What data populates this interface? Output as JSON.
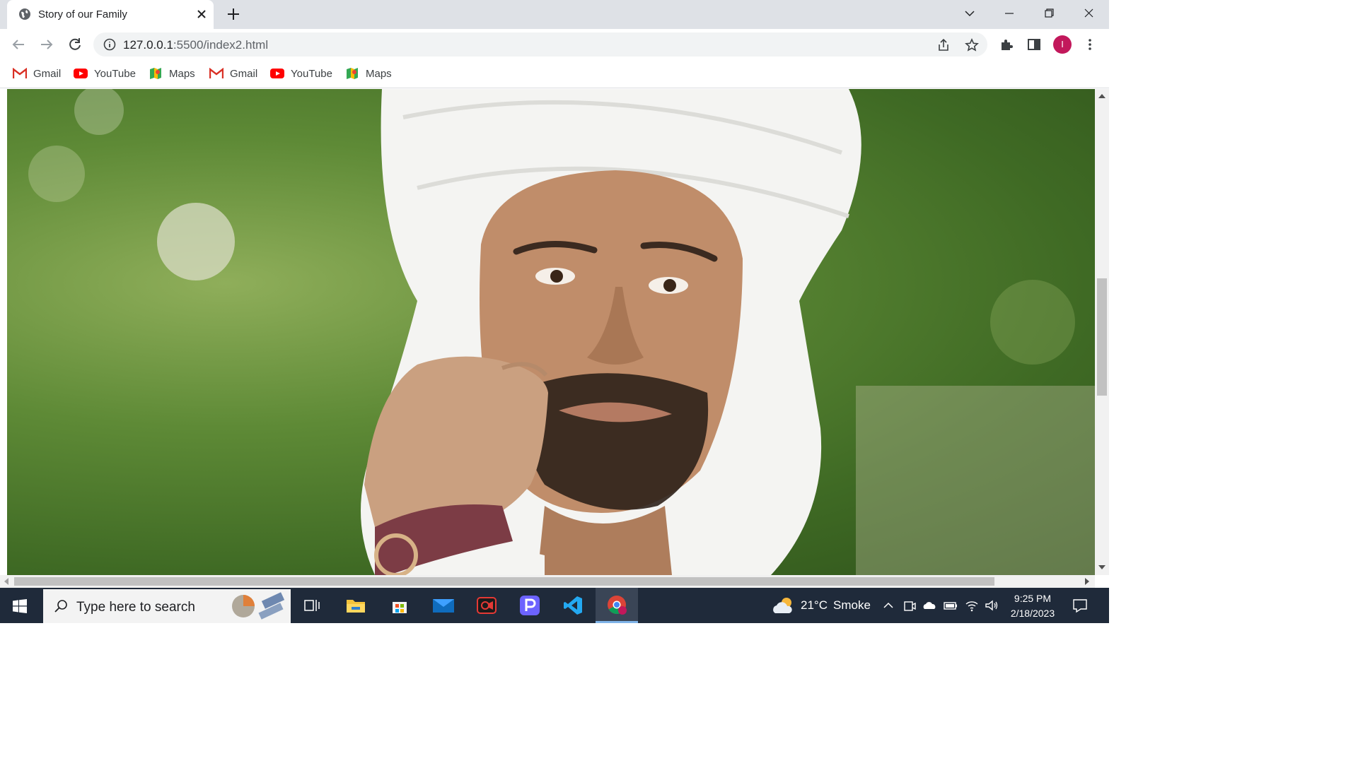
{
  "tab": {
    "title": "Story of our Family"
  },
  "address_bar": {
    "host": "127.0.0.1",
    "path": ":5500/index2.html"
  },
  "profile": {
    "initial": "I",
    "color": "#c2185b"
  },
  "bookmarks": [
    {
      "label": "Gmail",
      "icon": "gmail-icon"
    },
    {
      "label": "YouTube",
      "icon": "youtube-icon"
    },
    {
      "label": "Maps",
      "icon": "maps-icon"
    },
    {
      "label": "Gmail",
      "icon": "gmail-icon"
    },
    {
      "label": "YouTube",
      "icon": "youtube-icon"
    },
    {
      "label": "Maps",
      "icon": "maps-icon"
    }
  ],
  "page": {
    "hero_image": "portrait-photo"
  },
  "taskbar": {
    "search_placeholder": "Type here to search",
    "weather": {
      "temp": "21°C",
      "condition": "Smoke"
    },
    "time": "9:25 PM",
    "date": "2/18/2023",
    "apps": [
      "task-view",
      "file-explorer",
      "microsoft-store",
      "mail",
      "screen-recorder",
      "p-app",
      "vs-code",
      "chrome"
    ]
  }
}
